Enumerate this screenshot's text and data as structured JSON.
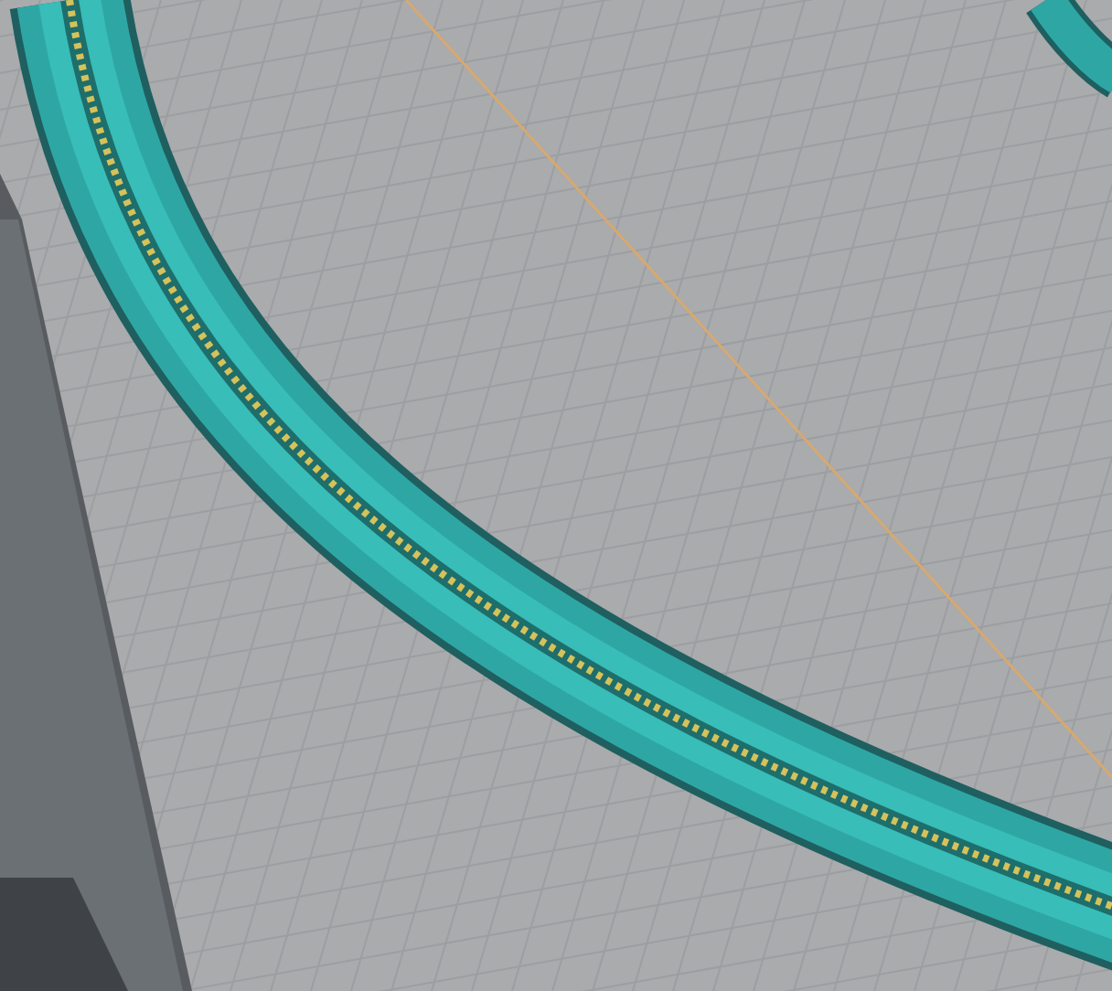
{
  "viewport": {
    "kind": "layer-preview"
  }
}
